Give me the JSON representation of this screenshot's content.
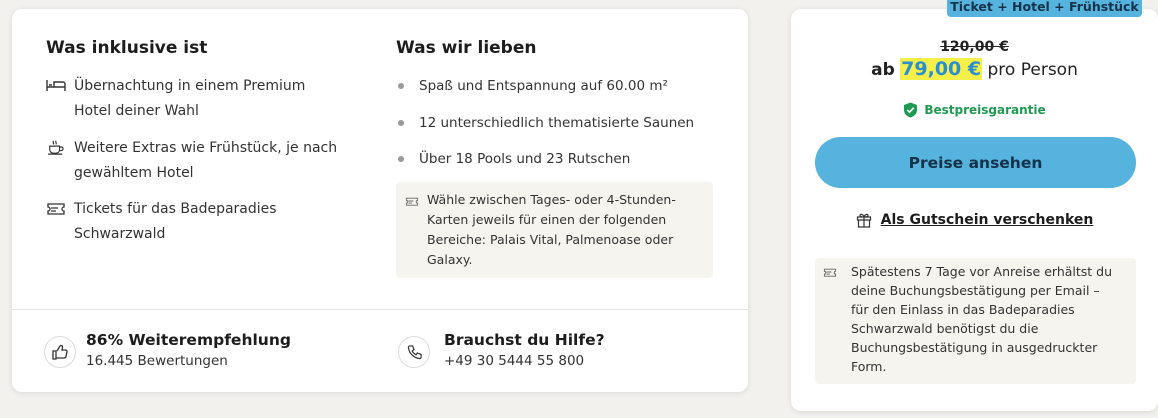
{
  "left_card": {
    "included": {
      "heading": "Was inklusive ist",
      "items": [
        {
          "icon": "bed-icon",
          "line1": "Übernachtung in einem Premium",
          "line2": "Hotel deiner Wahl"
        },
        {
          "icon": "coffee-cup-icon",
          "line1": "Weitere Extras wie Frühstück, je nach",
          "line2": "gewähltem Hotel"
        },
        {
          "icon": "ticket-icon",
          "line1": "Tickets für das Badeparadies",
          "line2": "Schwarzwald"
        }
      ]
    },
    "love": {
      "heading": "Was wir lieben",
      "bullets": [
        "Spaß und Entspannung auf 60.00 m²",
        "12 unterschiedlich thematisierte Saunen",
        "Über 18 Pools und 23 Rutschen"
      ],
      "info": {
        "icon": "ticket-icon",
        "lines": [
          "Wähle zwischen Tages- oder 4-Stunden-",
          "Karten jeweils für einen der folgenden",
          "Bereiche: Palais Vital, Palmenoase oder",
          "Galaxy."
        ]
      }
    },
    "recommendation": {
      "icon": "thumbs-up-icon",
      "title": "86% Weiterempfehlung",
      "subtitle": "16.445 Bewertungen"
    },
    "help": {
      "icon": "phone-icon",
      "title": "Brauchst du Hilfe?",
      "phone": "+49 30 5444 55 800"
    }
  },
  "right_card": {
    "badge": "Ticket + Hotel + Frühstück",
    "old_price": "120,00 €",
    "price_prefix": "ab",
    "price": "79,00 €",
    "price_suffix": "pro Person",
    "guarantee": "Bestpreisgarantie",
    "cta_label": "Preise ansehen",
    "gift_label": "Als Gutschein verschenken",
    "notice": {
      "icon": "ticket-icon",
      "lines": [
        "Spätestens 7 Tage vor Anreise erhältst du",
        "deine Buchungsbestätigung per Email –",
        "für den Einlass in das Badeparadies",
        "Schwarzwald benötigst du die",
        "Buchungsbestätigung in ausgedruckter",
        "Form."
      ]
    }
  },
  "colors": {
    "accent_blue": "#55b3de",
    "price_blue": "#2a8fd0",
    "highlight_yellow": "#f5ef4a",
    "guarantee_green": "#1f9a52"
  }
}
